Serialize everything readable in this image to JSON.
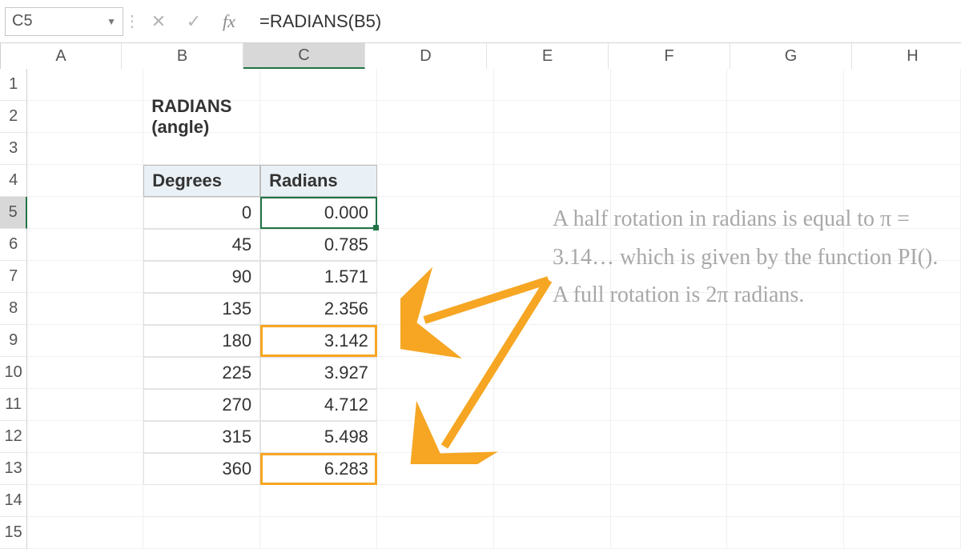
{
  "formula_bar": {
    "name_box": "C5",
    "fx_label": "fx",
    "formula": "=RADIANS(B5)"
  },
  "columns": [
    "A",
    "B",
    "C",
    "D",
    "E",
    "F",
    "G",
    "H"
  ],
  "selected_col": "C",
  "selected_row": "5",
  "row_numbers": [
    "1",
    "2",
    "3",
    "4",
    "5",
    "6",
    "7",
    "8",
    "9",
    "10",
    "11",
    "12",
    "13",
    "14",
    "15"
  ],
  "cells": {
    "B2": "RADIANS (angle)",
    "B4": "Degrees",
    "C4": "Radians"
  },
  "data_rows": [
    {
      "row": "5",
      "deg": "0",
      "rad": "0.000"
    },
    {
      "row": "6",
      "deg": "45",
      "rad": "0.785"
    },
    {
      "row": "7",
      "deg": "90",
      "rad": "1.571"
    },
    {
      "row": "8",
      "deg": "135",
      "rad": "2.356"
    },
    {
      "row": "9",
      "deg": "180",
      "rad": "3.142"
    },
    {
      "row": "10",
      "deg": "225",
      "rad": "3.927"
    },
    {
      "row": "11",
      "deg": "270",
      "rad": "4.712"
    },
    {
      "row": "12",
      "deg": "315",
      "rad": "5.498"
    },
    {
      "row": "13",
      "deg": "360",
      "rad": "6.283"
    }
  ],
  "highlight_rows": [
    "9",
    "13"
  ],
  "annotation": "A half rotation in radians is equal to π = 3.14… which is given by the function PI(). A full rotation is 2π radians.",
  "colors": {
    "accent_green": "#217346",
    "highlight_orange": "#f6a623",
    "header_fill": "#eaf1f6",
    "anno_text": "#a8a8a8"
  }
}
